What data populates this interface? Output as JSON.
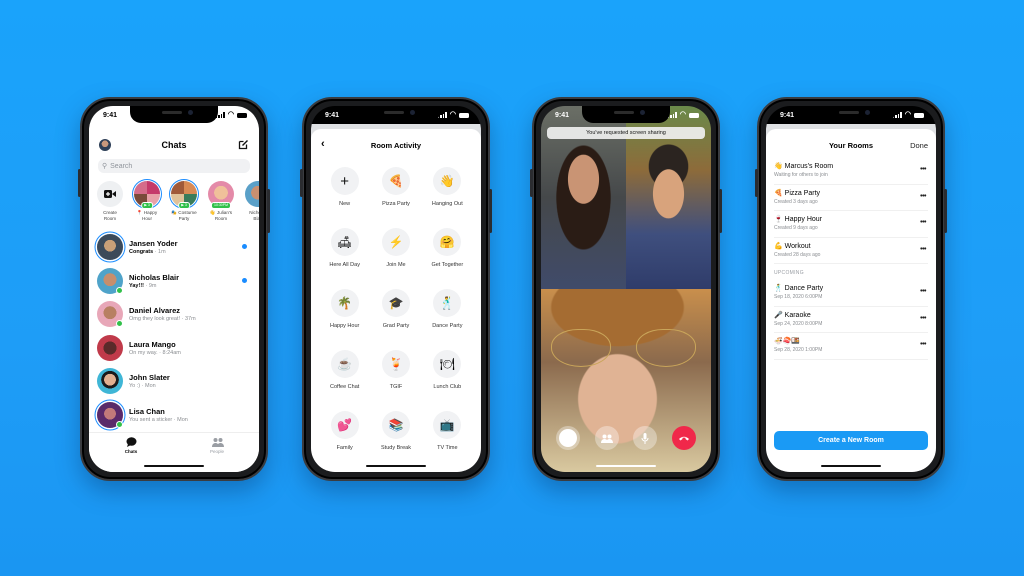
{
  "background_color": "#1aa3fb",
  "phones": {
    "chats": {
      "status_time": "9:41",
      "title": "Chats",
      "compose_icon": "compose-icon",
      "search_placeholder": "Search",
      "stories": [
        {
          "label": "Create\nRoom",
          "icon": "video-plus-icon"
        },
        {
          "label": "📍 Happy\nHour",
          "badge": "▶ 3"
        },
        {
          "label": "🎭 Costume\nParty",
          "badge": "▶ 3"
        },
        {
          "label": "👋 Julian's\nRoom",
          "badge": "10:30PM"
        },
        {
          "label": "Nicholas\nBlair"
        }
      ],
      "conversations": [
        {
          "name": "Jansen Yoder",
          "message": "Congrats",
          "time": "1m",
          "unread": true,
          "online": false,
          "ring": true
        },
        {
          "name": "Nicholas Blair",
          "message": "Yay!!!",
          "time": "9m",
          "unread": true,
          "online": true,
          "ring": false
        },
        {
          "name": "Daniel Alvarez",
          "message": "Omg they look great!",
          "time": "37m",
          "unread": false,
          "online": true,
          "ring": false
        },
        {
          "name": "Laura Mango",
          "message": "On my way.",
          "time": "8:24am",
          "unread": false,
          "online": false,
          "ring": false
        },
        {
          "name": "John Slater",
          "message": "Yo :)",
          "time": "Mon",
          "unread": false,
          "online": false,
          "ring": false
        },
        {
          "name": "Lisa Chan",
          "message": "You sent a sticker",
          "time": "Mon",
          "unread": false,
          "online": true,
          "ring": true
        }
      ],
      "tabs": [
        {
          "label": "Chats",
          "icon": "chat-bubble-icon",
          "active": true
        },
        {
          "label": "People",
          "icon": "people-icon",
          "active": false
        }
      ]
    },
    "room_activity": {
      "status_time": "9:41",
      "title": "Room Activity",
      "back_icon": "chevron-left-icon",
      "activities": [
        {
          "label": "New",
          "emoji": "+"
        },
        {
          "label": "Pizza Party",
          "emoji": "🍕"
        },
        {
          "label": "Hanging Out",
          "emoji": "👋"
        },
        {
          "label": "Here All Day",
          "emoji": "🛋"
        },
        {
          "label": "Join Me",
          "emoji": "⚡"
        },
        {
          "label": "Get Together",
          "emoji": "🤗"
        },
        {
          "label": "Happy Hour",
          "emoji": "🌴"
        },
        {
          "label": "Grad Party",
          "emoji": "🎓"
        },
        {
          "label": "Dance Party",
          "emoji": "🕺"
        },
        {
          "label": "Coffee Chat",
          "emoji": "☕"
        },
        {
          "label": "TGIF",
          "emoji": "🍹"
        },
        {
          "label": "Lunch Club",
          "emoji": "🍽"
        },
        {
          "label": "Family",
          "emoji": "💕"
        },
        {
          "label": "Study Break",
          "emoji": "📚"
        },
        {
          "label": "TV Time",
          "emoji": "📺"
        }
      ]
    },
    "video_call": {
      "status_time": "9:41",
      "toast": "You've requested screen sharing",
      "controls": [
        "capture-button",
        "participants-button",
        "microphone-button",
        "end-call-button"
      ]
    },
    "your_rooms": {
      "status_time": "9:41",
      "title": "Your Rooms",
      "done_label": "Done",
      "rooms": [
        {
          "name": "👋 Marcus's Room",
          "subtitle": "Waiting for others to join"
        },
        {
          "name": "🍕 Pizza Party",
          "subtitle": "Created 3 days ago"
        },
        {
          "name": "🍷 Happy Hour",
          "subtitle": "Created 9 days ago"
        },
        {
          "name": "💪 Workout",
          "subtitle": "Created 28 days ago"
        }
      ],
      "upcoming_label": "UPCOMING",
      "upcoming": [
        {
          "name": "🕺 Dance Party",
          "subtitle": "Sep 18, 2020   6:00PM"
        },
        {
          "name": "🎤 Karaoke",
          "subtitle": "Sep 24, 2020   8:00PM"
        },
        {
          "name": "🍜🍣🍱",
          "subtitle": "Sep 28, 2020   1:00PM"
        }
      ],
      "more_label": "•••",
      "create_button": "Create a New Room"
    }
  }
}
